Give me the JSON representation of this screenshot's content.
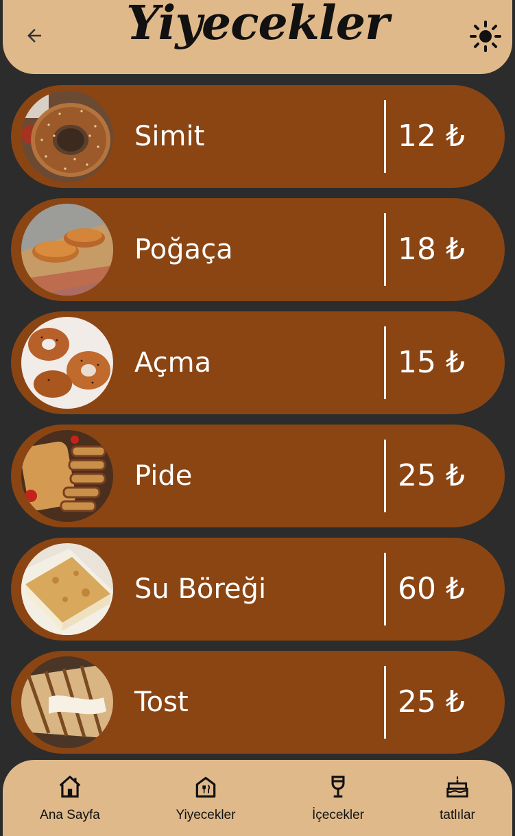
{
  "header": {
    "title": "Yiyecekler",
    "back_icon": "arrow-left-icon",
    "theme_icon": "sun-icon"
  },
  "items": [
    {
      "name": "Simit",
      "price": "12 ₺",
      "image": "simit-image"
    },
    {
      "name": "Poğaça",
      "price": "18 ₺",
      "image": "pogaca-image"
    },
    {
      "name": "Açma",
      "price": "15 ₺",
      "image": "acma-image"
    },
    {
      "name": "Pide",
      "price": "25 ₺",
      "image": "pide-image"
    },
    {
      "name": "Su Böreği",
      "price": "60 ₺",
      "image": "su-boregi-image"
    },
    {
      "name": "Tost",
      "price": "25 ₺",
      "image": "tost-image"
    }
  ],
  "nav": [
    {
      "label": "Ana Sayfa",
      "icon": "home-icon"
    },
    {
      "label": "Yiyecekler",
      "icon": "restaurant-icon"
    },
    {
      "label": "İçecekler",
      "icon": "wine-glass-icon"
    },
    {
      "label": "tatlılar",
      "icon": "cake-icon"
    }
  ],
  "colors": {
    "background": "#2c2c2c",
    "header": "#e0b98a",
    "card": "#8b4513",
    "text_light": "#ffffff",
    "text_dark": "#111111"
  }
}
